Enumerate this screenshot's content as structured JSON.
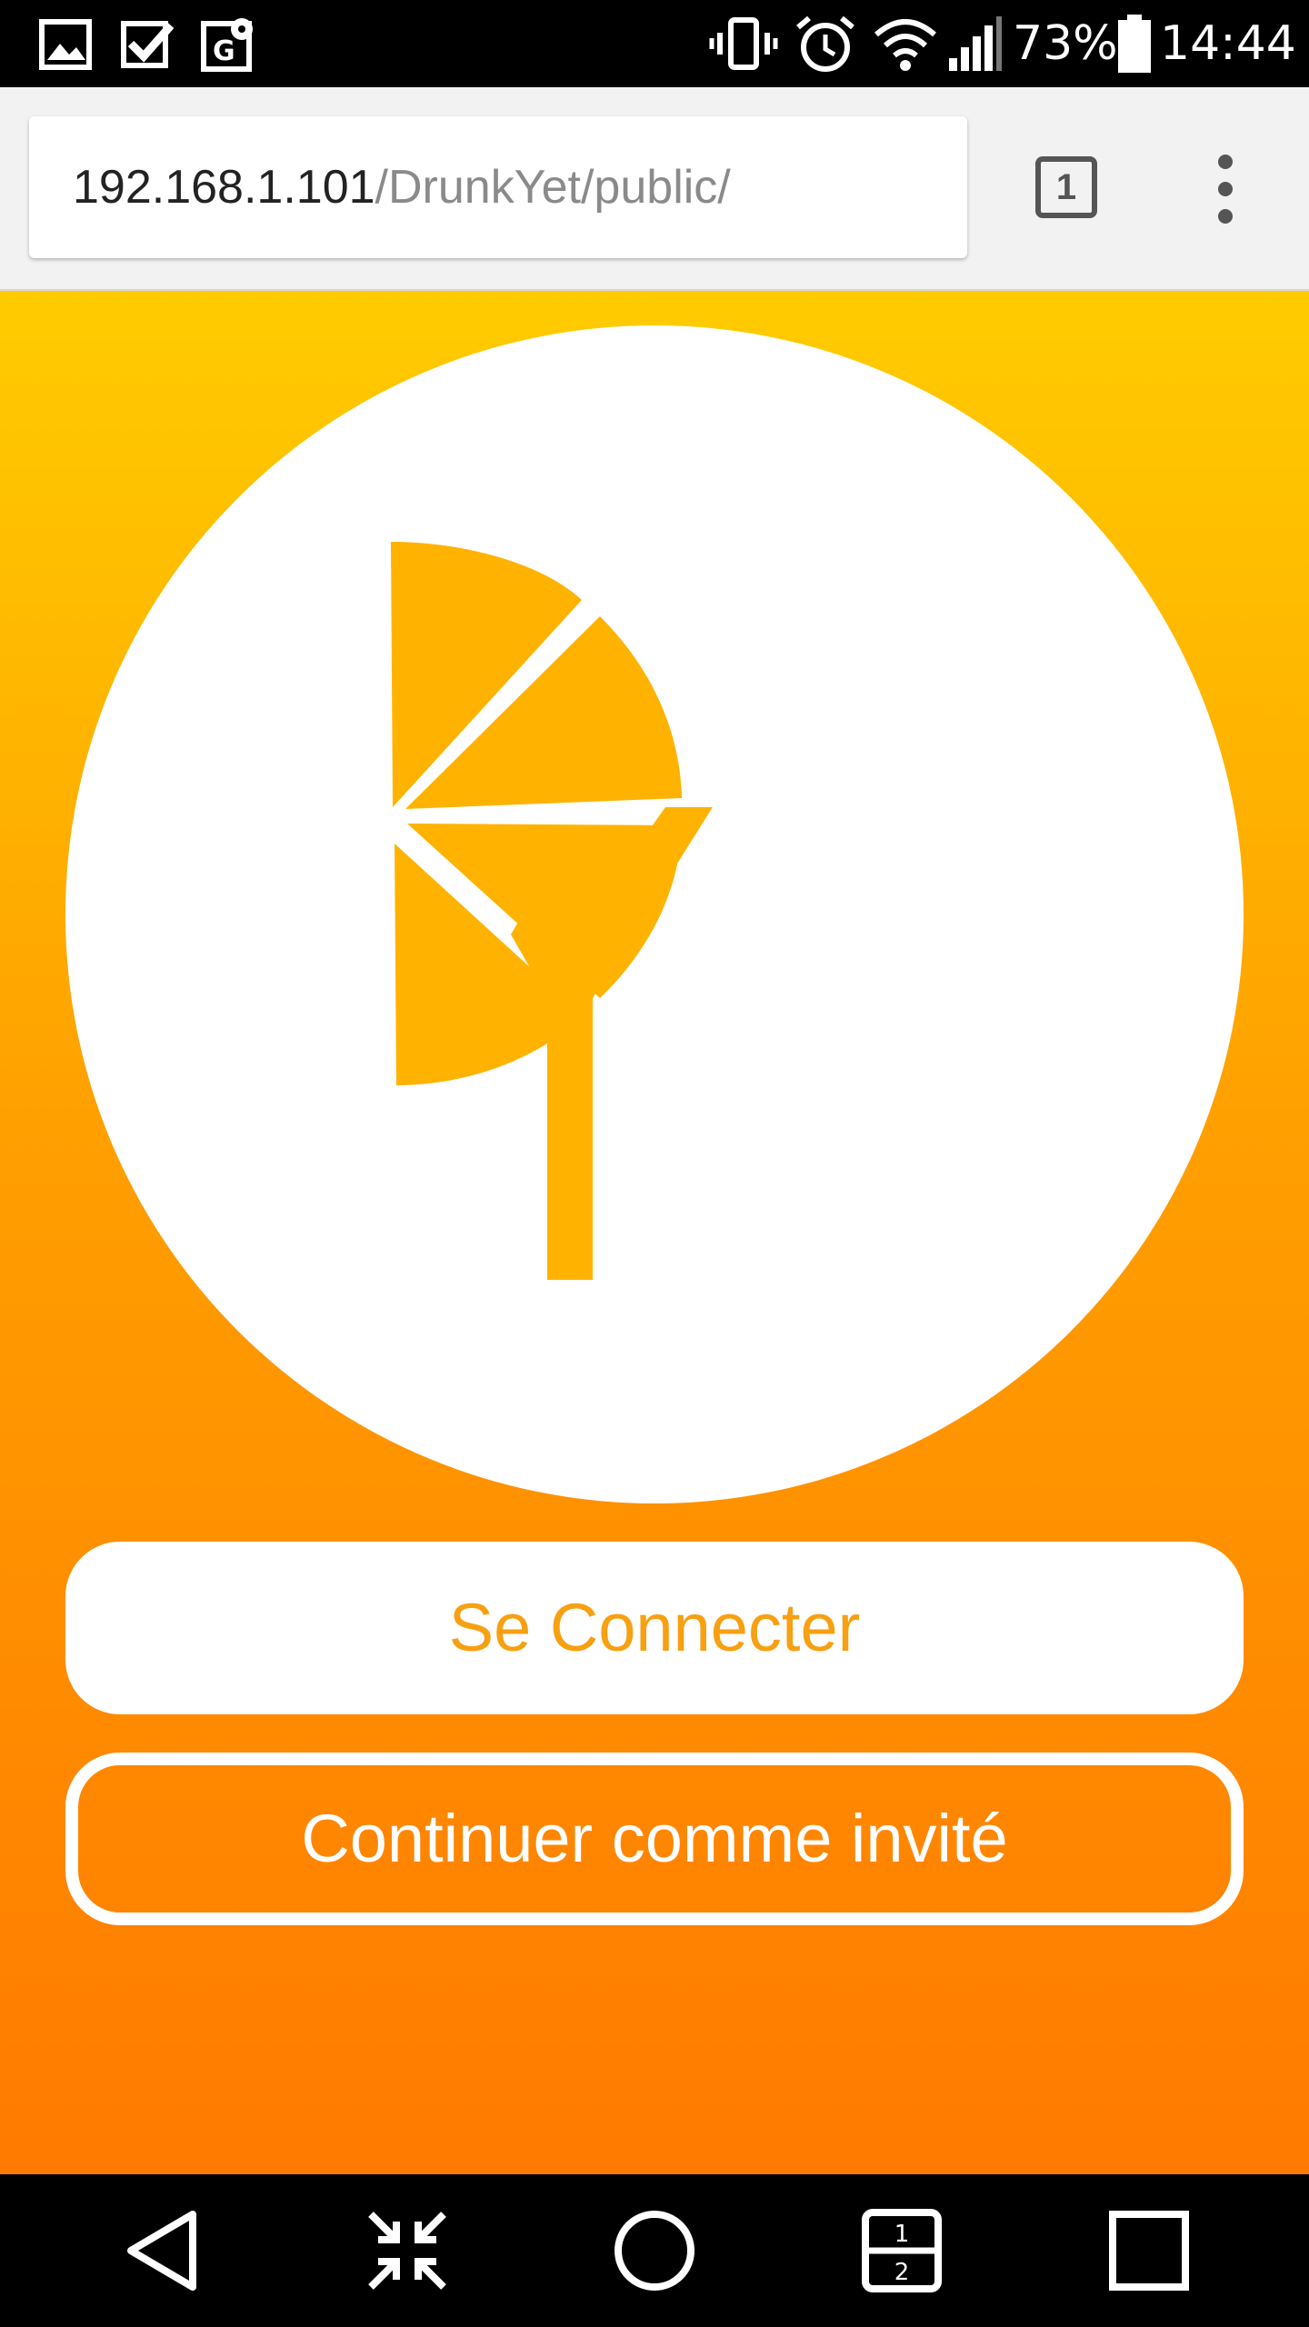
{
  "status_bar": {
    "battery_percent": "73%",
    "time": "14:44",
    "left_icons": [
      "gallery-icon",
      "task-check-icon",
      "maps-icon"
    ],
    "right_icons": [
      "vibrate-icon",
      "alarm-icon",
      "wifi-icon",
      "signal-icon",
      "battery-icon"
    ]
  },
  "browser": {
    "url_host": "192.168.1.101",
    "url_path": "/DrunkYet/public/",
    "tab_count": "1"
  },
  "colors": {
    "gradient_top": "#ffcc00",
    "gradient_bottom": "#ff7a00",
    "logo_orange": "#ffb300",
    "accent_text": "#f7a012"
  },
  "main": {
    "login_button": "Se Connecter",
    "guest_button": "Continuer comme invité"
  },
  "nav_bar": {
    "icons": [
      "back-icon",
      "collapse-icon",
      "home-icon",
      "dual-window-icon",
      "recents-icon"
    ]
  }
}
